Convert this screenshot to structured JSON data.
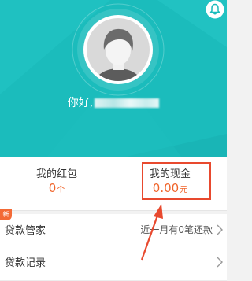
{
  "header": {
    "greeting": "你好,",
    "phone_masked": "",
    "icons": {
      "notification": "bell-icon",
      "avatar": "user-avatar-icon"
    }
  },
  "stats": {
    "red_packet": {
      "title": "我的红包",
      "value": "0",
      "unit": "个"
    },
    "cash": {
      "title": "我的现金",
      "value": "0.00",
      "unit": "元"
    }
  },
  "menu": {
    "new_badge": "新",
    "items": [
      {
        "label": "贷款管家",
        "sub": "近一月有0笔还款",
        "icon": "chevron-right-icon"
      },
      {
        "label": "贷款记录",
        "sub": "",
        "icon": "chevron-right-icon"
      }
    ]
  },
  "colors": {
    "hero_bg": "#1bbcbc",
    "accent": "#f0642a",
    "highlight_box": "#e8492e"
  }
}
